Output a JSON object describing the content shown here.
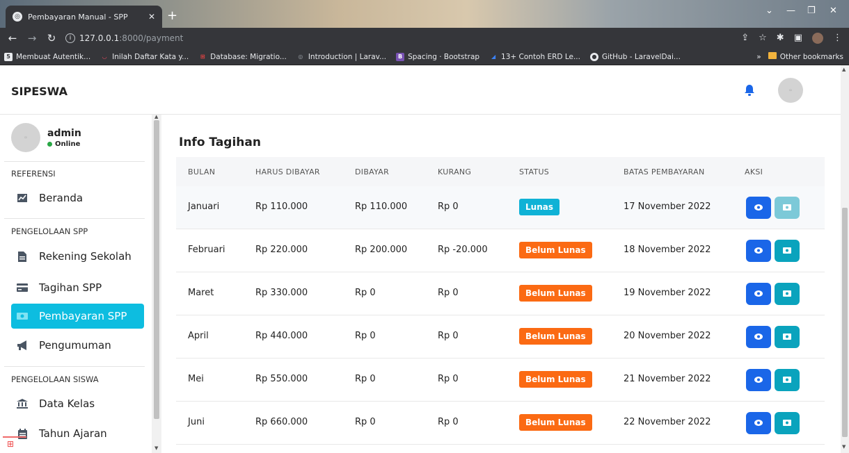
{
  "browser": {
    "tab_title": "Pembayaran Manual - SPP",
    "tab_close": "✕",
    "new_tab": "+",
    "url_host": "127.0.0.1",
    "url_rest": ":8000/payment",
    "bookmarks": [
      {
        "label": "Membuat Autentik...",
        "icon_color": "#e8eaed"
      },
      {
        "label": "Inilah Daftar Kata y...",
        "icon_color": "#e84a5f"
      },
      {
        "label": "Database: Migratio...",
        "icon_color": "#ef4444"
      },
      {
        "label": "Introduction | Larav...",
        "icon_color": "#9aa0a6"
      },
      {
        "label": "Spacing · Bootstrap",
        "icon_color": "#7952b3"
      },
      {
        "label": "13+ Contoh ERD Le...",
        "icon_color": "#3b82f6"
      },
      {
        "label": "GitHub - LaravelDai...",
        "icon_color": "#e8eaed"
      }
    ],
    "more_bookmarks": "»",
    "other_bookmarks": "Other bookmarks"
  },
  "app": {
    "brand": "SIPESWA",
    "user": {
      "name": "admin",
      "status": "Online"
    },
    "sidebar": {
      "sections": [
        {
          "title": "REFERENSI",
          "items": [
            {
              "label": "Beranda",
              "icon": "chart-icon"
            }
          ]
        },
        {
          "title": "PENGELOLAAN SPP",
          "items": [
            {
              "label": "Rekening Sekolah",
              "icon": "file-icon"
            },
            {
              "label": "Tagihan SPP",
              "icon": "credit-card-icon"
            },
            {
              "label": "Pembayaran SPP",
              "icon": "money-icon",
              "active": true
            },
            {
              "label": "Pengumuman",
              "icon": "megaphone-icon"
            }
          ]
        },
        {
          "title": "PENGELOLAAN SISWA",
          "items": [
            {
              "label": "Data Kelas",
              "icon": "building-icon"
            },
            {
              "label": "Tahun Ajaran",
              "icon": "calendar-icon"
            }
          ]
        }
      ]
    },
    "content": {
      "title": "Info Tagihan",
      "columns": [
        "BULAN",
        "HARUS DIBAYAR",
        "DIBAYAR",
        "KURANG",
        "STATUS",
        "BATAS PEMBAYARAN",
        "AKSI"
      ],
      "rows": [
        {
          "bulan": "Januari",
          "harus": "Rp 110.000",
          "dibayar": "Rp 110.000",
          "kurang": "Rp 0",
          "status": "Lunas",
          "batas": "17 November 2022"
        },
        {
          "bulan": "Februari",
          "harus": "Rp 220.000",
          "dibayar": "Rp 200.000",
          "kurang": "Rp -20.000",
          "status": "Belum Lunas",
          "batas": "18 November 2022"
        },
        {
          "bulan": "Maret",
          "harus": "Rp 330.000",
          "dibayar": "Rp 0",
          "kurang": "Rp 0",
          "status": "Belum Lunas",
          "batas": "19 November 2022"
        },
        {
          "bulan": "April",
          "harus": "Rp 440.000",
          "dibayar": "Rp 0",
          "kurang": "Rp 0",
          "status": "Belum Lunas",
          "batas": "20 November 2022"
        },
        {
          "bulan": "Mei",
          "harus": "Rp 550.000",
          "dibayar": "Rp 0",
          "kurang": "Rp 0",
          "status": "Belum Lunas",
          "batas": "21 November 2022"
        },
        {
          "bulan": "Juni",
          "harus": "Rp 660.000",
          "dibayar": "Rp 0",
          "kurang": "Rp 0",
          "status": "Belum Lunas",
          "batas": "22 November 2022"
        }
      ]
    },
    "colors": {
      "active": "#0dbde0",
      "lunas": "#0fb2d6",
      "belum_lunas": "#fb6a13",
      "view_button": "#1a66e8",
      "pay_button": "#0aa3bd"
    }
  }
}
